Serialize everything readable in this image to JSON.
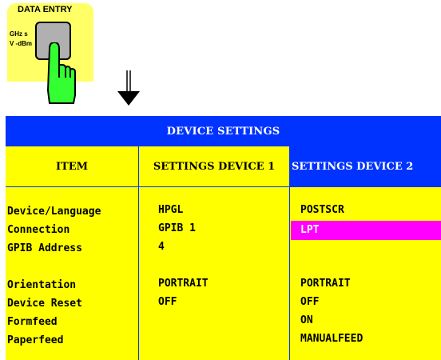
{
  "data_entry": {
    "title": "DATA ENTRY",
    "unit_line1": "GHz s",
    "unit_line2": "V -dBm"
  },
  "table": {
    "title": "DEVICE SETTINGS",
    "columns": [
      "ITEM",
      "SETTINGS DEVICE 1",
      "SETTINGS DEVICE 2"
    ],
    "items_group1": [
      "Device/Language",
      "Connection",
      "GPIB Address"
    ],
    "items_group2": [
      "Orientation",
      "Device Reset",
      "Formfeed",
      "Paperfeed"
    ],
    "device1_group1": [
      "HPGL",
      "GPIB 1",
      "4"
    ],
    "device1_group2": [
      "PORTRAIT",
      "OFF"
    ],
    "device2_group1": [
      "POSTSCR",
      "LPT"
    ],
    "device2_group2": [
      "PORTRAIT",
      "OFF",
      "ON",
      "MANUALFEED"
    ]
  },
  "colors": {
    "header_blue": "#0033ff",
    "cell_yellow": "#ffff00",
    "highlight_magenta": "#ff00ff",
    "hand_green": "#33ff33"
  },
  "icons": [
    "hand-pointer-icon",
    "arrow-down-icon"
  ]
}
